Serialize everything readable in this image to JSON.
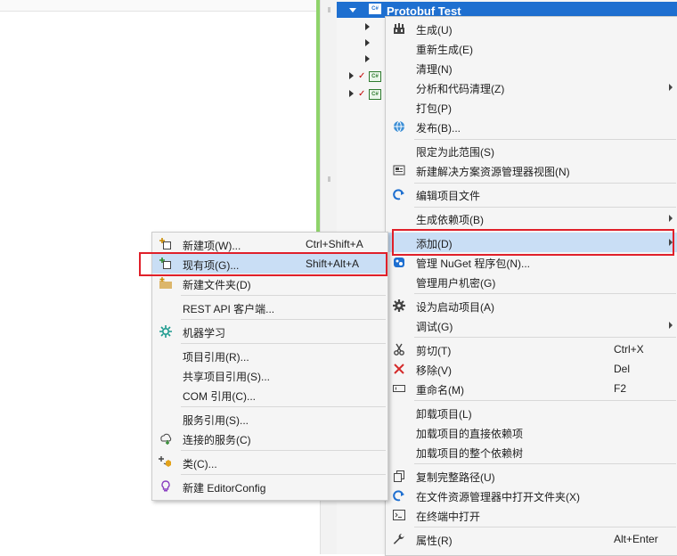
{
  "colors": {
    "selection": "#1e6fd0",
    "highlight": "#c9def5",
    "annotation": "#e0202a",
    "accent_green": "#8fd36b"
  },
  "tree": {
    "project": "Protobuf Test",
    "project_icon": "csharp-project-icon",
    "cs_badge": "C#"
  },
  "context_menu": [
    {
      "label": "生成(U)",
      "icon": "build-icon"
    },
    {
      "label": "重新生成(E)"
    },
    {
      "label": "清理(N)"
    },
    {
      "label": "分析和代码清理(Z)",
      "submenu": true
    },
    {
      "label": "打包(P)"
    },
    {
      "label": "发布(B)...",
      "icon": "globe-icon"
    },
    {
      "label": "限定为此范围(S)"
    },
    {
      "label": "新建解决方案资源管理器视图(N)",
      "icon": "new-view-icon"
    },
    {
      "label": "编辑项目文件",
      "icon": "edit-redo-icon"
    },
    {
      "label": "生成依赖项(B)",
      "submenu": true
    },
    {
      "label": "添加(D)",
      "submenu": true
    },
    {
      "label": "管理 NuGet 程序包(N)...",
      "icon": "nuget-icon"
    },
    {
      "label": "管理用户机密(G)"
    },
    {
      "label": "设为启动项目(A)",
      "icon": "gear-icon"
    },
    {
      "label": "调试(G)",
      "submenu": true
    },
    {
      "label": "剪切(T)",
      "shortcut": "Ctrl+X",
      "icon": "scissors-icon"
    },
    {
      "label": "移除(V)",
      "shortcut": "Del",
      "icon": "remove-x-icon"
    },
    {
      "label": "重命名(M)",
      "shortcut": "F2",
      "icon": "rename-icon"
    },
    {
      "label": "卸载项目(L)"
    },
    {
      "label": "加载项目的直接依赖项"
    },
    {
      "label": "加载项目的整个依赖树"
    },
    {
      "label": "复制完整路径(U)",
      "icon": "copy-icon"
    },
    {
      "label": "在文件资源管理器中打开文件夹(X)",
      "icon": "open-folder-arrow-icon"
    },
    {
      "label": "在终端中打开",
      "icon": "terminal-icon"
    },
    {
      "label": "属性(R)",
      "shortcut": "Alt+Enter",
      "icon": "wrench-icon"
    }
  ],
  "add_submenu": [
    {
      "label": "新建项(W)...",
      "shortcut": "Ctrl+Shift+A",
      "icon": "new-item-icon"
    },
    {
      "label": "现有项(G)...",
      "shortcut": "Shift+Alt+A",
      "icon": "existing-item-icon"
    },
    {
      "label": "新建文件夹(D)",
      "icon": "new-folder-icon"
    },
    {
      "label": "REST API 客户端..."
    },
    {
      "label": "机器学习",
      "icon": "machine-learning-icon"
    },
    {
      "label": "项目引用(R)..."
    },
    {
      "label": "共享项目引用(S)..."
    },
    {
      "label": "COM 引用(C)..."
    },
    {
      "label": "服务引用(S)..."
    },
    {
      "label": "连接的服务(C)",
      "icon": "connected-service-icon"
    },
    {
      "label": "类(C)...",
      "icon": "class-icon"
    },
    {
      "label": "新建 EditorConfig",
      "icon": "lightbulb-icon"
    }
  ]
}
